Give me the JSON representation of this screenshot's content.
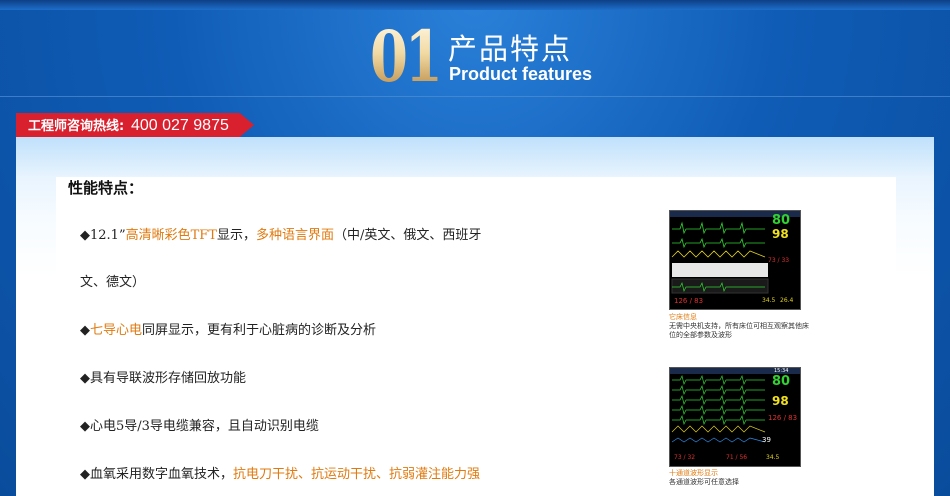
{
  "header": {
    "number": "01",
    "title_cn": "产品特点",
    "title_en": "Product features"
  },
  "hotline": {
    "label": "工程师咨询热线:",
    "number": "400 027 9875"
  },
  "section": {
    "title": "性能特点："
  },
  "features": [
    {
      "parts": [
        {
          "t": "◆12.1”"
        },
        {
          "t": "高清晰彩色TFT",
          "hl": true
        },
        {
          "t": "显示，"
        },
        {
          "t": "多种语言界面",
          "hl": true
        },
        {
          "t": "（中/英文、俄文、西班牙"
        }
      ]
    },
    {
      "parts": [
        {
          "t": "文、德文）"
        }
      ]
    },
    {
      "parts": [
        {
          "t": "◆"
        },
        {
          "t": "七导心电",
          "hl": true
        },
        {
          "t": "同屏显示，更有利于心脏病的诊断及分析"
        }
      ]
    },
    {
      "parts": [
        {
          "t": "◆具有导联波形存储回放功能"
        }
      ]
    },
    {
      "parts": [
        {
          "t": "◆心电5导/3导电缆兼容，且自动识别电缆"
        }
      ]
    },
    {
      "parts": [
        {
          "t": "◆血氧采用数字血氧技术，"
        },
        {
          "t": "抗电刀干扰、抗运动干扰、抗弱灌注能力强",
          "hl": true
        }
      ]
    }
  ],
  "monitors": [
    {
      "readings": {
        "hr": "80",
        "spo2": "98",
        "nibp": "73 / 33",
        "a": "126 / 83",
        "b": "34.5",
        "c": "26.4"
      },
      "caption_title": "它床信息",
      "caption_text": "无需中央机支持，所有床位可相互观察其他床位的全部参数及波形"
    },
    {
      "readings": {
        "time": "15:34",
        "hr": "80",
        "spo2": "98",
        "a": "126 / 83",
        "b": "73 / 32",
        "c": "71 / 56",
        "d": "39",
        "e": "34.5"
      },
      "caption_title": "十通道波形显示",
      "caption_text": "各通道波形可任意选择"
    }
  ],
  "colors": {
    "accent": "#e07a10",
    "hotline_bg": "#d8202e",
    "header_bg": "#0f5cb6"
  }
}
